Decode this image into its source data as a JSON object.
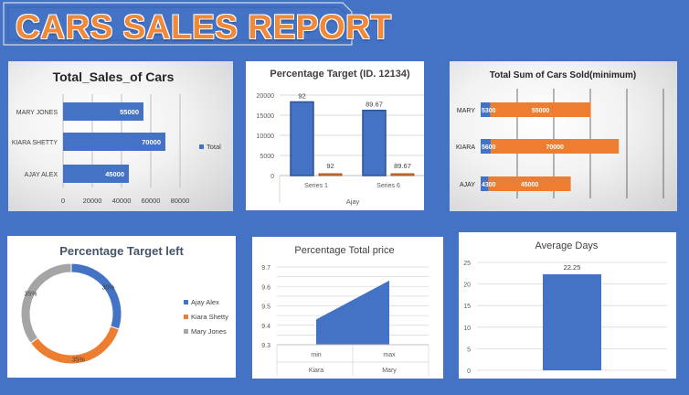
{
  "page": {
    "title": "CARS SALES  REPORT"
  },
  "colors": {
    "background": "#4472c4",
    "blue": "#4472c4",
    "orange": "#ed7d31",
    "gray": "#a5a5a5",
    "title_orange": "#f08a3a"
  },
  "chart_data": [
    {
      "id": "total-sales",
      "type": "bar",
      "orientation": "horizontal",
      "title": "Total_Sales_of Cars",
      "categories": [
        "MARY JONES",
        "KIARA SHETTY",
        "AJAY ALEX"
      ],
      "series": [
        {
          "name": "Total",
          "values": [
            55000,
            70000,
            45000
          ]
        }
      ],
      "data_labels": [
        "55000",
        "70000",
        "45000"
      ],
      "xlim": [
        0,
        80000
      ],
      "ticks": [
        "0",
        "20000",
        "40000",
        "60000",
        "80000"
      ],
      "grid": true,
      "legend": "right"
    },
    {
      "id": "percentage-target",
      "type": "bar",
      "title": "Percentage Target (ID. 12134)",
      "categories": [
        "Series 1",
        "Series 6"
      ],
      "series": [
        {
          "values": [
            18300,
            16200
          ],
          "labels": [
            "92",
            "89.67"
          ]
        },
        {
          "values": [
            92,
            89.67
          ],
          "labels": [
            "92",
            "89.67"
          ]
        }
      ],
      "xlabel": "Ajay",
      "ylim": [
        0,
        20000
      ],
      "ticks": [
        "0",
        "5000",
        "10000",
        "15000",
        "20000"
      ],
      "grid": true
    },
    {
      "id": "total-sum-sold",
      "type": "bar",
      "orientation": "horizontal",
      "stacked": true,
      "title": "Total Sum of Cars Sold(minimum)",
      "categories": [
        "MARY",
        "KIARA",
        "AJAY"
      ],
      "series": [
        {
          "values": [
            5300,
            5600,
            4300
          ],
          "labels": [
            "5300",
            "5600",
            "4300"
          ]
        },
        {
          "values": [
            55000,
            70000,
            45000
          ],
          "labels": [
            "55000",
            "70000",
            "45000"
          ]
        }
      ],
      "xlim": [
        0,
        100000
      ],
      "grid": true
    },
    {
      "id": "percentage-target-left",
      "type": "pie",
      "variant": "doughnut",
      "title": "Percentage Target left",
      "categories": [
        "Ajay Alex",
        "Kiara Shetty",
        "Mary Jones"
      ],
      "values": [
        30,
        35,
        35
      ],
      "labels": [
        "30%",
        "35%",
        "35%"
      ],
      "legend": "right"
    },
    {
      "id": "percentage-total-price",
      "type": "area",
      "title": "Percentage Total price",
      "categories": [
        "min",
        "max"
      ],
      "category_groups": [
        "Kiara",
        "Mary"
      ],
      "values": [
        9.43,
        9.63
      ],
      "ylim": [
        9.3,
        9.7
      ],
      "ticks": [
        "9.3",
        "9.35",
        "9.4",
        "9.45",
        "9.5",
        "9.55",
        "9.6",
        "9.65",
        "9.7"
      ],
      "grid": true
    },
    {
      "id": "average-days",
      "type": "bar",
      "title": "Average Days",
      "categories": [
        ""
      ],
      "values": [
        22.25
      ],
      "labels": [
        "22.25"
      ],
      "ylim": [
        0,
        25
      ],
      "ticks": [
        "0",
        "5",
        "10",
        "15",
        "20",
        "25"
      ],
      "grid": true
    }
  ]
}
